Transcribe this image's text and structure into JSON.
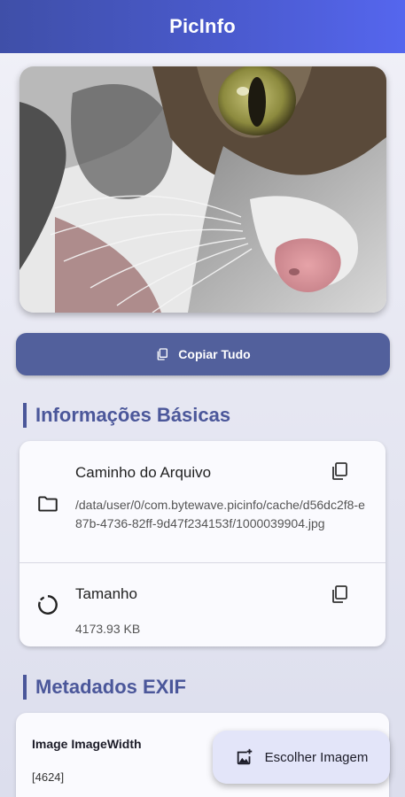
{
  "appbar": {
    "title": "PicInfo"
  },
  "actions": {
    "copy_all_label": "Copiar Tudo"
  },
  "basic": {
    "title": "Informações Básicas",
    "items": [
      {
        "label": "Caminho do Arquivo",
        "value": "/data/user/0/com.bytewave.picinfo/cache/d56dc2f8-e87b-4736-82ff-9d47f234153f/1000039904.jpg",
        "icon": "folder-icon"
      },
      {
        "label": "Tamanho",
        "value": "4173.93 KB",
        "icon": "file-size-icon"
      }
    ]
  },
  "exif": {
    "title": "Metadados EXIF",
    "items": [
      {
        "key": "Image ImageWidth",
        "value": "[4624]"
      }
    ]
  },
  "fab": {
    "label": "Escolher Imagem",
    "icon": "add-photo-icon"
  },
  "colors": {
    "appbar": "#4b5bd0",
    "primary_button": "#52609c",
    "section_accent": "#4b579a",
    "fab_bg": "#e3e5f9"
  }
}
